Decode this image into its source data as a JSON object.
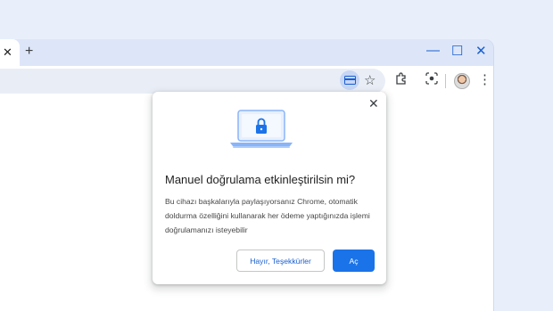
{
  "tabstrip": {
    "tab_close_glyph": "✕",
    "new_tab_glyph": "+",
    "minimize_glyph": "—",
    "maximize_glyph": "☐",
    "close_glyph": "✕"
  },
  "toolbar": {
    "icons": [
      "credit-card-icon",
      "star-icon",
      "extensions-icon",
      "lens-icon",
      "avatar",
      "more-icon"
    ]
  },
  "dialog": {
    "title": "Manuel doğrulama etkinleştirilsin mi?",
    "body": "Bu cihazı başkalarıyla paylaşıyorsanız Chrome, otomatik doldurma özelliğini kullanarak her ödeme yaptığınızda işlemi doğrulamanızı isteyebilir",
    "decline_label": "Hayır, Teşekkürler",
    "accept_label": "Aç",
    "close_glyph": "✕"
  },
  "colors": {
    "accent": "#1a73e8",
    "browser_frame": "#dde6f8",
    "background": "#e8effb"
  }
}
